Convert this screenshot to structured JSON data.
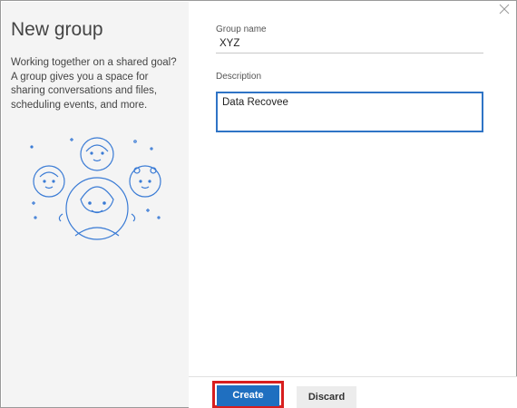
{
  "dialog": {
    "title": "New group",
    "intro": "Working together on a shared goal? A group gives you a space for sharing conversations and files, scheduling events, and more."
  },
  "form": {
    "group_name_label": "Group name",
    "group_name_value": "XYZ",
    "description_label": "Description",
    "description_value": "Data Recovee"
  },
  "footer": {
    "create_label": "Create",
    "discard_label": "Discard"
  },
  "icons": {
    "close": "close-icon",
    "illustration": "people-group-illustration"
  },
  "colors": {
    "accent": "#1f6fc0",
    "highlight": "#d81e1e",
    "illustration": "#3a7bd5"
  }
}
